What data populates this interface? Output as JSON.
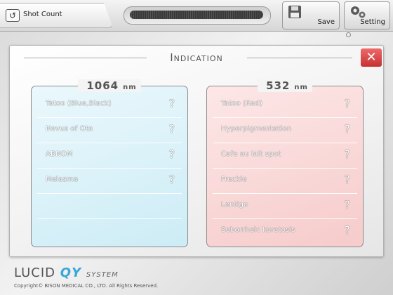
{
  "topbar": {
    "shot_count_label": "Shot Count",
    "save_label": "Save",
    "setting_label": "Setting"
  },
  "panel": {
    "title": "Indication",
    "close_glyph": "✕"
  },
  "columns": [
    {
      "wavelength": "1064",
      "unit": "nm",
      "items": [
        {
          "label": "Tatoo (Blue,Black)"
        },
        {
          "label": "Nevus of Ota"
        },
        {
          "label": "ABNOM"
        },
        {
          "label": "Melasma"
        }
      ]
    },
    {
      "wavelength": "532",
      "unit": "nm",
      "items": [
        {
          "label": "Tatoo (Red)"
        },
        {
          "label": "Hyperpigmentation"
        },
        {
          "label": "Cafe au lait spot"
        },
        {
          "label": "Freckle"
        },
        {
          "label": "Lentigo"
        },
        {
          "label": "Seborrheic keratosis"
        }
      ]
    }
  ],
  "help_glyph": "?",
  "footer": {
    "brand_lucid": "LUCID",
    "brand_qy": "QY",
    "brand_system": "SYSTEM",
    "copyright": "Copyright© BISON MEDICAL CO., LTD. All Rights Reserved."
  },
  "colors": {
    "close": "#d84545",
    "left_column": "#d6f0f8",
    "right_column": "#f9d4d4",
    "brand_accent": "#3aa6d9"
  },
  "icons": {
    "shot_count": "undo-icon",
    "save": "save-disk-icon",
    "setting": "gears-icon",
    "close": "close-icon",
    "help": "question-icon"
  }
}
